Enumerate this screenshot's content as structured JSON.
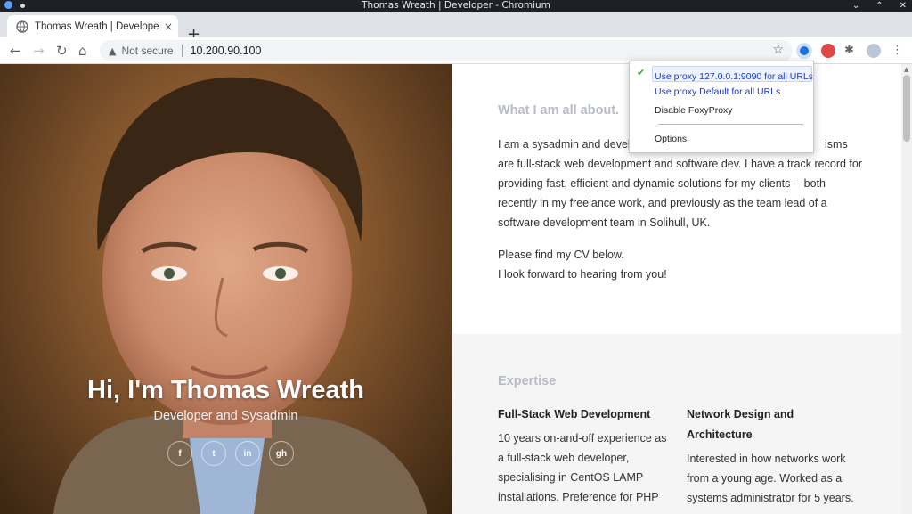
{
  "window": {
    "title": "Thomas Wreath | Developer - Chromium"
  },
  "tab": {
    "title": "Thomas Wreath | Develope",
    "close": "×",
    "new_tab": "+"
  },
  "toolbar": {
    "back": "←",
    "forward": "→",
    "reload": "↻",
    "home": "⌂",
    "security_label": "Not secure",
    "url": "10.200.90.100",
    "bookmark": "☆"
  },
  "hero": {
    "title": "Hi, I'm Thomas Wreath",
    "subtitle": "Developer and Sysadmin",
    "socials": [
      "f",
      "t",
      "in",
      "gh"
    ]
  },
  "about": {
    "heading": "What I am all about.",
    "para1_lines": [
      "I am a sysadmin and devel",
      "are full-stack web development and software dev. I have a track record for",
      "providing fast, efficient and dynamic solutions for my clients -- both",
      "recently in my freelance work, and previously as the team lead of a",
      "software development team in Solihull, UK."
    ],
    "para1_tail": "isms",
    "para2_lines": [
      "Please find my CV below.",
      "I look forward to hearing from you!"
    ]
  },
  "expertise": {
    "heading": "Expertise",
    "col1": {
      "title": "Full-Stack Web Development",
      "text_lines": [
        "10 years on-and-off experience as",
        "a full-stack web developer,",
        "specialising in CentOS LAMP",
        "installations. Preference for PHP"
      ]
    },
    "col2": {
      "title_lines": [
        "Network Design and",
        "Architecture"
      ],
      "text_lines": [
        "Interested in how networks work",
        "from a young age. Worked as a",
        "systems administrator for 5 years."
      ]
    }
  },
  "foxyproxy": {
    "check": "✔",
    "items": [
      "Use proxy 127.0.0.1:9090 for all URLs",
      "Use proxy Default for all URLs",
      "Disable FoxyProxy",
      "Options"
    ]
  },
  "colors": {
    "link": "#1a3cc8",
    "heading": "#b8bcc6",
    "check": "#36a836"
  }
}
